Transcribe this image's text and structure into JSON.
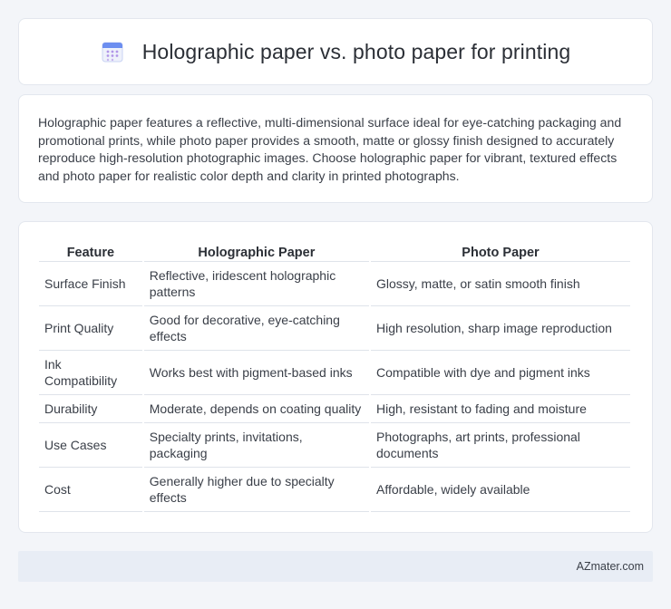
{
  "header": {
    "title": "Holographic paper vs. photo paper for printing",
    "icon": "calendar-icon",
    "icon_colors": {
      "top": "#6c8ef0",
      "body": "#eef1fb",
      "dots": "#b196e8"
    }
  },
  "intro": {
    "text": "Holographic paper features a reflective, multi-dimensional surface ideal for eye-catching packaging and promotional prints, while photo paper provides a smooth, matte or glossy finish designed to accurately reproduce high-resolution photographic images. Choose holographic paper for vibrant, textured effects and photo paper for realistic color depth and clarity in printed photographs."
  },
  "table": {
    "headers": [
      "Feature",
      "Holographic Paper",
      "Photo Paper"
    ],
    "rows": [
      [
        "Surface Finish",
        "Reflective, iridescent holographic patterns",
        "Glossy, matte, or satin smooth finish"
      ],
      [
        "Print Quality",
        "Good for decorative, eye-catching effects",
        "High resolution, sharp image reproduction"
      ],
      [
        "Ink Compatibility",
        "Works best with pigment-based inks",
        "Compatible with dye and pigment inks"
      ],
      [
        "Durability",
        "Moderate, depends on coating quality",
        "High, resistant to fading and moisture"
      ],
      [
        "Use Cases",
        "Specialty prints, invitations, packaging",
        "Photographs, art prints, professional documents"
      ],
      [
        "Cost",
        "Generally higher due to specialty effects",
        "Affordable, widely available"
      ]
    ]
  },
  "footer": {
    "brand": "AZmater.com"
  }
}
